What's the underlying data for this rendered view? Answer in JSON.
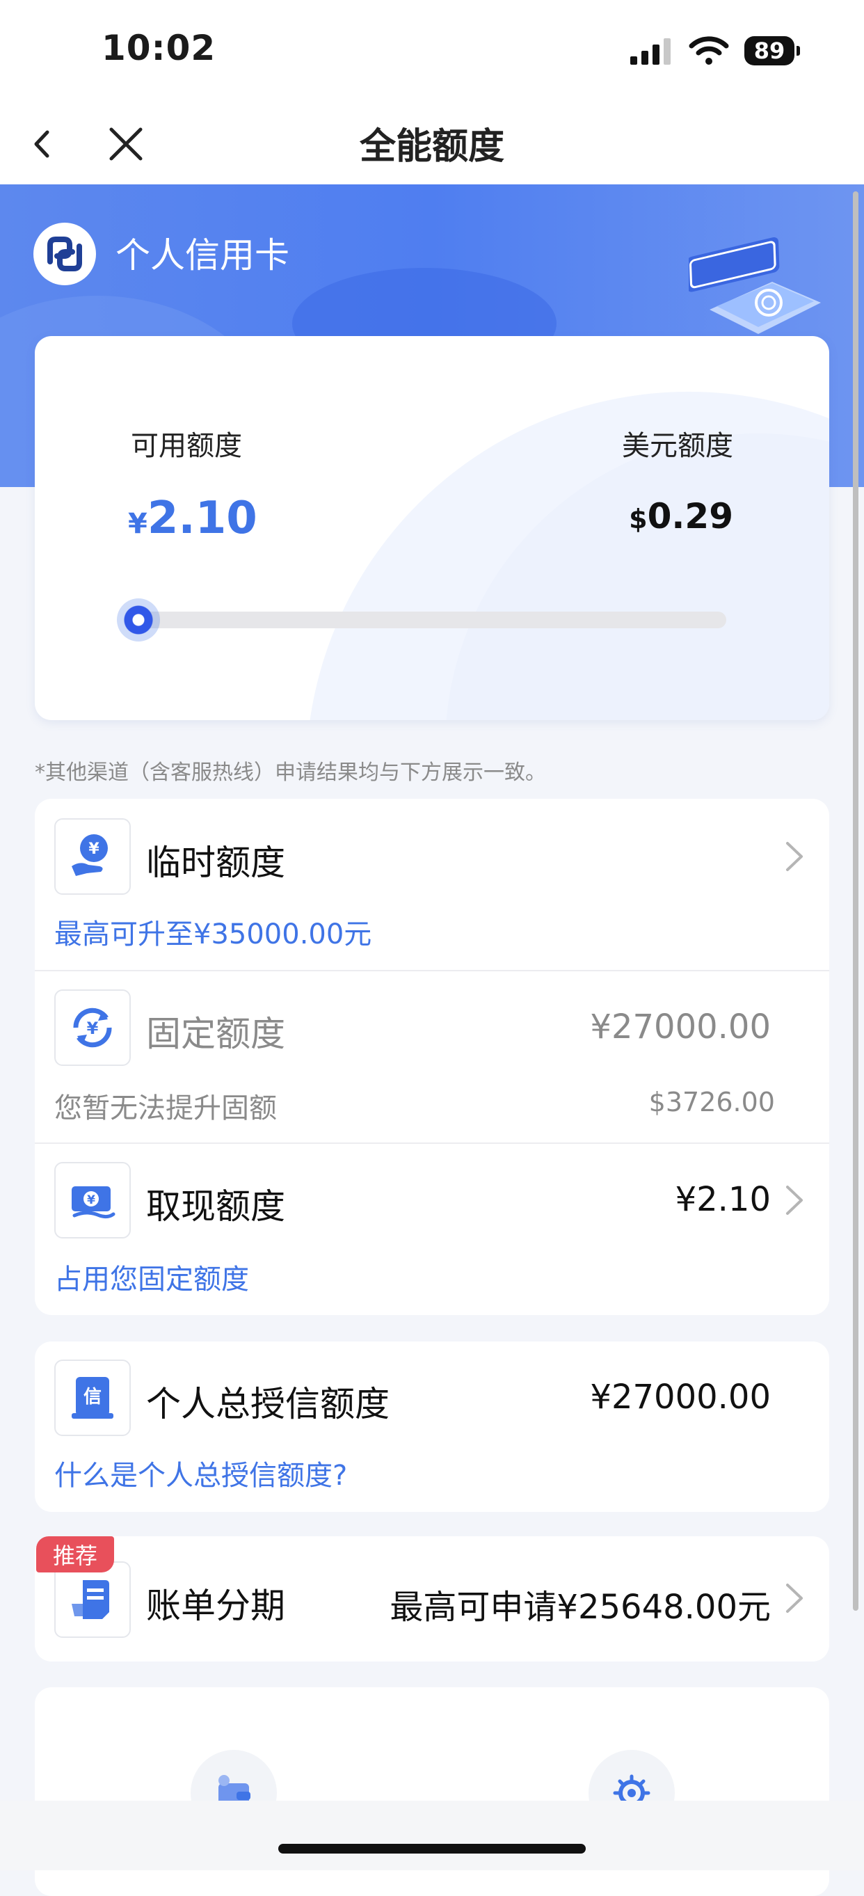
{
  "status_bar": {
    "time": "10:02",
    "battery": "89"
  },
  "nav": {
    "title": "全能额度"
  },
  "card": {
    "name": "个人信用卡"
  },
  "limit": {
    "available_label": "可用额度",
    "available_currency": "¥",
    "available_value": "2.10",
    "usd_label": "美元额度",
    "usd_currency": "$",
    "usd_value": "0.29",
    "progress_fraction": 0.0
  },
  "notice": "*其他渠道（含客服热线）申请结果均与下方展示一致。",
  "rows": {
    "temporary": {
      "title": "临时额度",
      "subtitle": "最高可升至¥35000.00元"
    },
    "fixed": {
      "title": "固定额度",
      "value": "¥27000.00",
      "subtitle": "您暂无法提升固额",
      "usd_value": "$3726.00"
    },
    "cash": {
      "title": "取现额度",
      "value": "¥2.10",
      "subtitle": "占用您固定额度"
    },
    "total_credit": {
      "title": "个人总授信额度",
      "value": "¥27000.00",
      "subtitle": "什么是个人总授信额度?"
    },
    "installment": {
      "badge": "推荐",
      "title": "账单分期",
      "value": "最高可申请¥25648.00元"
    }
  },
  "colors": {
    "accent": "#3f74e6",
    "hero": "#5d88ee",
    "badge": "#e8505b"
  }
}
